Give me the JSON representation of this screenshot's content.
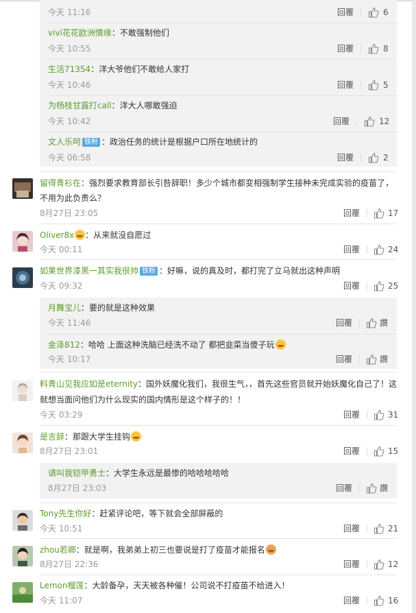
{
  "reply_label": "回覆",
  "reply_label_alt": "回覆",
  "zan_label": "讚",
  "thread1_replies": [
    {
      "user": "",
      "text": "",
      "time": "今天 11:16",
      "likes": "6"
    },
    {
      "user": "vivi花花欧洲情缘",
      "text": "：不敢强制他们",
      "time": "今天 10:55",
      "likes": "8"
    },
    {
      "user": "生活71354",
      "text": "：洋大爷他们不敢给人家打",
      "time": "今天 10:46",
      "likes": "5"
    },
    {
      "user": "为杨枝甘露打call",
      "text": "：洋大人哪敢强迫",
      "time": "今天 10:42",
      "likes": "12"
    },
    {
      "user": "文人乐呵",
      "badge": "铁粉",
      "text": "：政治任务的统计是根据户口所在地统计的",
      "time": "今天 06:58",
      "likes": "2"
    }
  ],
  "comments": [
    {
      "user": "留得青衫在",
      "text1": "：强烈要求教育部长引咎辞职！多少个城市都变相强制学生接种未完成实验的疫苗了，",
      "text2": "不用为此负责么？",
      "time": "8月27日 23:05",
      "likes": "17"
    },
    {
      "user": "Oliver8x",
      "text1": "：从来就没自愿过",
      "time": "今天 00:11",
      "likes": "24"
    },
    {
      "user": "如果世界漆黑一其实我很帅",
      "badge": "铁粉",
      "text1": "：好嘛，说的真及时，都打完了立马就出这种声明",
      "time": "今天 09:32",
      "likes": "25"
    },
    {
      "user": "料青山见我应如是eternity",
      "text1": "：国外妖魔化我们，我很生气，，首先这些官员就开始妖魔化自己了！这",
      "text2": "就想当面问他们为什么现实的国内情形是这个样子的！！",
      "time": "今天 03:29",
      "likes": "31"
    },
    {
      "user": "是言辞",
      "text1": "：那跟大学生挂钩",
      "time": "8月27日 23:01",
      "likes": "15"
    },
    {
      "user": "Tony先生你好",
      "text1": "：赶紧评论吧，等下就会全部屏蔽的",
      "time": "今天 10:51",
      "likes": "21"
    },
    {
      "user": "zhou若卿",
      "text1": "：就是啊，我弟弟上初三也要说是打了疫苗才能报名",
      "time": "8月27日 22:36",
      "likes": "12"
    },
    {
      "user": "Lemon榴莲",
      "text1": "：大龄备孕，天天被各种催！公司说不打疫苗不给进入！",
      "time": "今天 11:07",
      "likes": "16"
    }
  ],
  "sub_replies_3": [
    {
      "user": "月舞宝儿",
      "text": "：要的就是这种效果",
      "time": "今天 11:46"
    },
    {
      "user": "金泽812",
      "text": "：哈哈 上面这种洗脑已经洗不动了 都把韭菜当傻子玩",
      "time": "今天 10:17"
    }
  ],
  "sub_replies_5": [
    {
      "user": "请叫我铠甲勇士",
      "text": "：大学生永远是最惨的哈哈哈哈哈",
      "time": "8月27日 23:03"
    }
  ]
}
